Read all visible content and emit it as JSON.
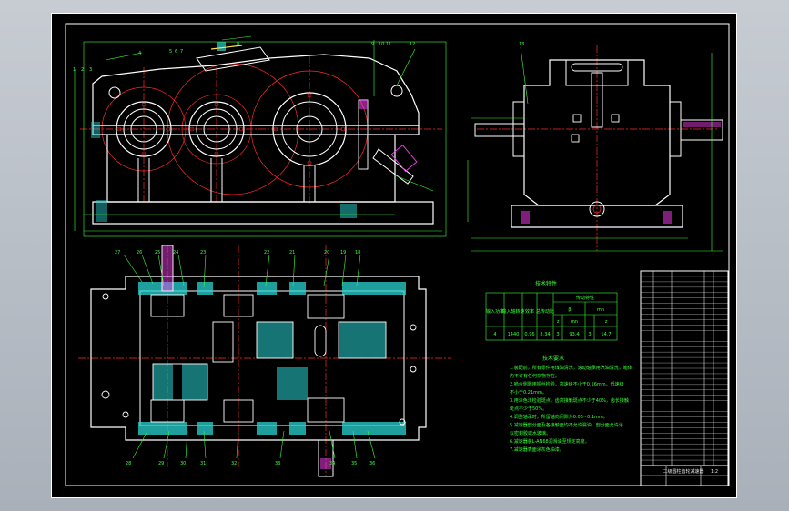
{
  "colors": {
    "background": "#b8bec6",
    "sheet": "#000000",
    "outline": "#ffffff",
    "centerline": "#ff2b2b",
    "dimension": "#39ff39",
    "hatch": "#2ad3d3",
    "accent": "#ff3df5",
    "yellow": "#ffe14a"
  },
  "tech_table": {
    "title": "技术特性",
    "headers": [
      "输入功率",
      "输入轴转速",
      "效率",
      "总传动比",
      "传动特性"
    ],
    "sub_headers": [
      "β",
      "mn",
      "z",
      "mn",
      "z"
    ],
    "row": [
      "4",
      "1440",
      "0.96",
      "8.34",
      "3",
      "93.4",
      "3",
      "14.7"
    ]
  },
  "requirements": {
    "title": "技术要求",
    "lines": [
      "1.装配前，所有零件用煤油清洗，滚动轴承用汽油清洗，箱体",
      "  内不许有任何杂物存在。",
      "2.啮合侧隙用铅丝检验，高速级不小于0.16mm，低速级",
      "  不小于0.21mm。",
      "3.用涂色法检验斑点，齿高接触斑点不少于40%，齿长接触",
      "  斑点不少于50%。",
      "4.调整轴承时，所留轴向间隙为0.05~0.1mm。",
      "5.减速器剖分面及各接触面均不允许漏油，剖分面允许涂",
      "  以密封胶或水玻璃。",
      "6.减速器装L-AN68润滑油至规定高度。",
      "7.减速器表面涂灰色油漆。"
    ]
  },
  "title_block": {
    "drawing_name": "二级圆柱齿轮减速器",
    "scale": "1:2"
  }
}
